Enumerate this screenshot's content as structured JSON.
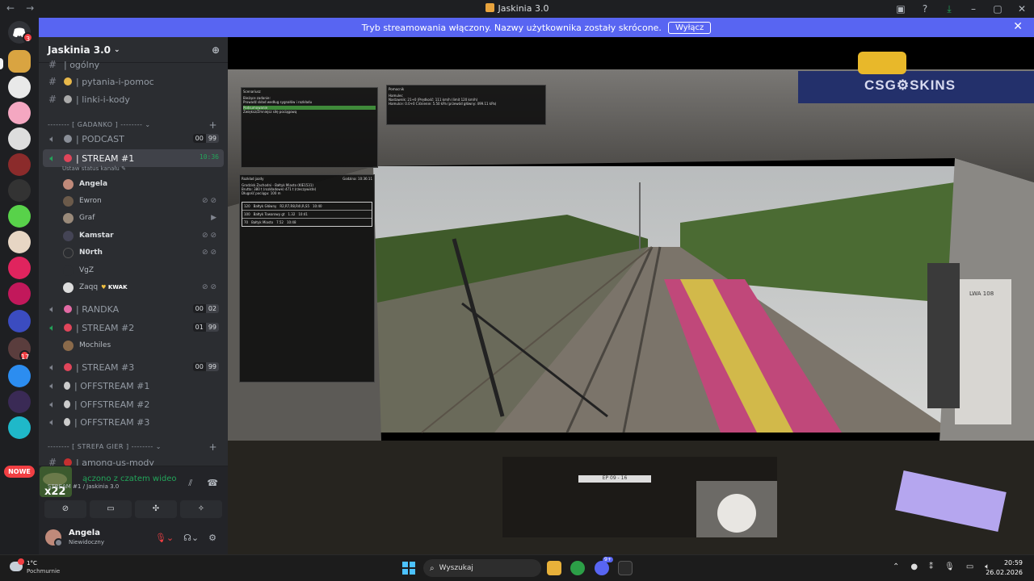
{
  "window": {
    "title": "Jaskinia 3.0",
    "back": "←",
    "forward": "→"
  },
  "banner": {
    "text": "Tryb streamowania włączony. Nazwy użytkownika zostały skrócone.",
    "button": "Wyłącz"
  },
  "servers": {
    "home_badge": "3",
    "server_badge": "17",
    "new_label": "NOWE"
  },
  "guild": {
    "name": "Jaskinia 3.0"
  },
  "channels": [
    {
      "name": "| ogólny",
      "type": "text"
    },
    {
      "name": "| pytania-i-pomoc",
      "type": "text"
    },
    {
      "name": "| linki-i-kody",
      "type": "text"
    }
  ],
  "categories": {
    "gadanko": "-------- [ GADANKO ] --------",
    "strefa": "-------- [ STREFA GIER ] --------"
  },
  "voice": {
    "podcast": {
      "name": "| PODCAST",
      "count": "00",
      "limit": "99"
    },
    "stream1": {
      "name": "| STREAM #1",
      "timer": "10:36",
      "status": "Ustaw status kanału"
    },
    "randka": {
      "name": "| RANDKA",
      "count": "00",
      "limit": "02"
    },
    "stream2": {
      "name": "| STREAM #2",
      "count": "01",
      "limit": "99"
    },
    "stream3": {
      "name": "| STREAM #3",
      "count": "00",
      "limit": "99"
    },
    "off1": {
      "name": "| OFFSTREAM #1"
    },
    "off2": {
      "name": "| OFFSTREAM #2"
    },
    "off3": {
      "name": "| OFFSTREAM #3"
    },
    "among": {
      "name": "| among-us-mody"
    }
  },
  "members_stream1": [
    {
      "name": "Angela",
      "bold": true,
      "icons": ""
    },
    {
      "name": "Ewron",
      "bold": false,
      "icons": "⊘ ⊘"
    },
    {
      "name": "Graf",
      "bold": false,
      "icons": "▶"
    },
    {
      "name": "Kamstar",
      "bold": true,
      "icons": "⊘ ⊘"
    },
    {
      "name": "N0rth",
      "bold": true,
      "icons": "⊘ ⊘"
    },
    {
      "name": "VgZ",
      "bold": false,
      "icons": ""
    },
    {
      "name": "Zaqq",
      "bold": false,
      "icons": "⊘ ⊘",
      "tag": "KWAK"
    }
  ],
  "members_stream2": [
    {
      "name": "Mochiles",
      "bold": false
    }
  ],
  "voice_panel": {
    "title": "ączono z czatem wideo",
    "subtitle": "STREAM #1 / Jaskinia 3.0",
    "avatar_text": "x22"
  },
  "user": {
    "name": "Angela",
    "status": "Niewidoczny"
  },
  "stage": {
    "watermark": "CSG⚙SKINS",
    "win1_title": "Scenariusz",
    "win1_lines": [
      "Bieżące zadanie:",
      "Prowadź skład według sygnałów i rozkładu",
      "Podsumowanie",
      "Zwiększ/Zmniejsz siłę pociągową"
    ],
    "win2_title": "Pomocnik",
    "win2_lines": [
      "Hamulec",
      "Nastawnik: 21+0 (Prędkość: 111 km/h (limit 120 km/h)",
      "Hamulce: 0.0+0   Ciśnienie: 5.50 kPa (przewód główny: 499.11 kPa)"
    ],
    "win3_title": "Rozkład jazdy",
    "win3_time": "Godzina: 10:36:11",
    "win3_lines": [
      "Grodzisk Zachodni - Bałtyk Miasto (KIE1531)",
      "Brutto: 380 t (rozkładowe) 471 t (rzeczywiste)",
      "Długość pociągu: 100 m"
    ],
    "timetable": [
      [
        "120",
        "Bałtyk Główny",
        "R2,R7,R8,R4l,R,S5",
        "10:40"
      ],
      [
        "100",
        "Bałtyk Towarowy gt",
        "1.32",
        "10:41"
      ],
      [
        "70",
        "Bałtyk Miasto",
        "7.52",
        "10:48"
      ]
    ],
    "panel_label": "LWA 108",
    "plate_label": "EP 09 - 16"
  },
  "taskbar": {
    "temp": "1°C",
    "weather": "Pochmurnie",
    "search": "Wyszukaj",
    "time": "20:59",
    "date": "26.02.2026",
    "discord_badge": "9+"
  }
}
